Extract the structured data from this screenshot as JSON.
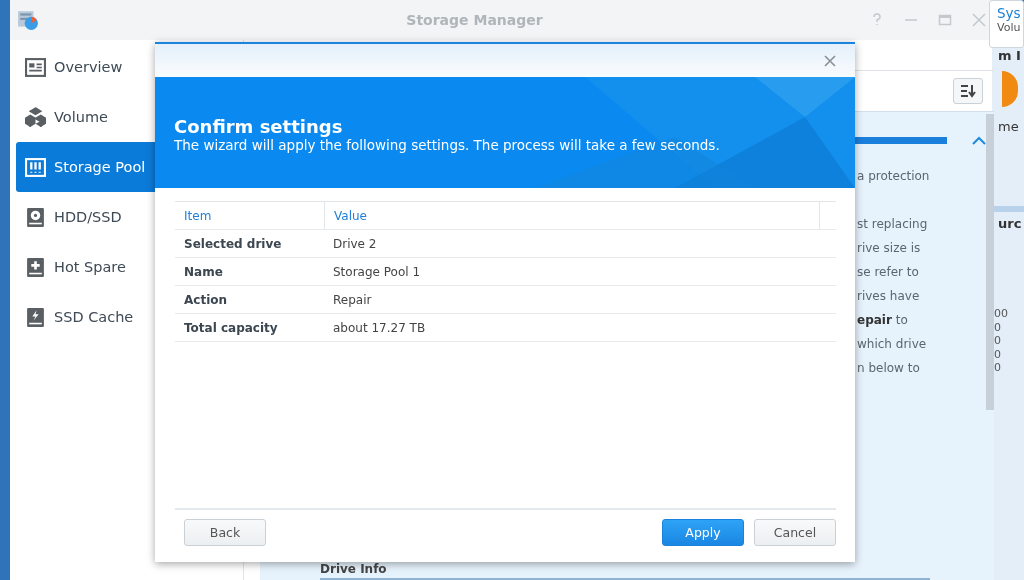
{
  "notification": {
    "title": "Sys",
    "text": "Volu"
  },
  "side_widget": {
    "texts": [
      "m I",
      "me",
      "urc"
    ],
    "axis_labels": [
      "00",
      "0",
      "0",
      "0",
      "0"
    ]
  },
  "main_window": {
    "title": "Storage Manager"
  },
  "sidebar": {
    "items": [
      {
        "label": "Overview",
        "kind": "overview",
        "selected": false
      },
      {
        "label": "Volume",
        "kind": "volume",
        "selected": false
      },
      {
        "label": "Storage Pool",
        "kind": "pool",
        "selected": true
      },
      {
        "label": "HDD/SSD",
        "kind": "disk",
        "selected": false
      },
      {
        "label": "Hot Spare",
        "kind": "spare",
        "selected": false
      },
      {
        "label": "SSD Cache",
        "kind": "cache",
        "selected": false
      }
    ]
  },
  "background_panel": {
    "lines": [
      "a protection",
      "st replacing",
      "rive size is",
      "se refer to",
      "rives have",
      "**epair** to",
      "which drive",
      "n below to"
    ],
    "section_heading": "Drive Info"
  },
  "dialog": {
    "title": "Confirm settings",
    "subtitle": "The wizard will apply the following settings. The process will take a few seconds.",
    "table": {
      "columns": [
        "Item",
        "Value"
      ],
      "rows": [
        [
          "Selected drive",
          "Drive 2"
        ],
        [
          "Name",
          "Storage Pool 1"
        ],
        [
          "Action",
          "Repair"
        ],
        [
          "Total capacity",
          "about 17.27 TB"
        ]
      ]
    },
    "buttons": [
      {
        "label": "Back",
        "kind": "secondary"
      },
      {
        "label": "Apply",
        "kind": "primary"
      },
      {
        "label": "Cancel",
        "kind": "secondary"
      }
    ]
  }
}
